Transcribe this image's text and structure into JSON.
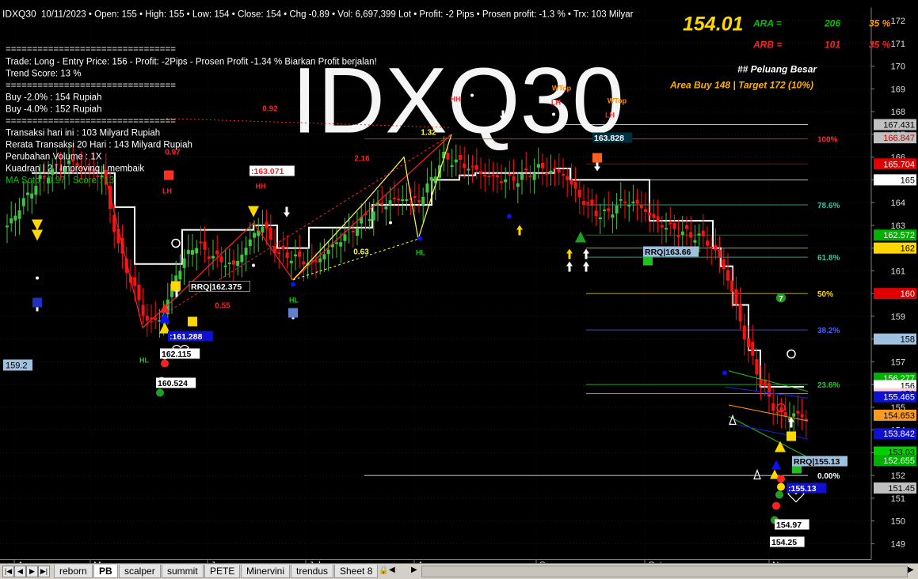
{
  "header": {
    "symbol": "IDXQ30",
    "stats": "10/11/2023  • Open: 155  • High: 155  • Low: 154  • Close: 154  • Chg -0.89  • Vol: 6,697,399 Lot  • Profit: -2 Pips  • Prosen profit: -1.3 %  • Trx: 103 Milyar",
    "last_price": "154.01",
    "ara_label": "ARA =",
    "ara_value": "206",
    "ara_pct": "35  %",
    "arb_label": "ARB =",
    "arb_value": "101",
    "arb_pct": "35  %",
    "peluang": "## Peluang Besar",
    "area_buy": "Area Buy 148 | Target 172 (10%)",
    "watermark": "IDXQ30"
  },
  "info_panel": {
    "rule": "================================",
    "lines": [
      "Trade: Long - Entry Price: 156 - Profit: -2Pips  -  Prosen Profit -1.34 % Biarkan Profit berjalan!",
      "Trend Score: 13 %",
      "================================",
      "Buy -2.0% : 154 Rupiah",
      "Buy -4.0% : 152 Rupiah",
      "================================",
      "Transaksi hari ini : 103 Milyard Rupiah",
      "Rerata Transaksi 20 Hari  : 143 Milyard Rupiah",
      "Perubahan Volume  : 1X",
      "Kuadran |  2 | Improving | membaik",
      "MA Soto  : 0.97  | Score  : 13"
    ]
  },
  "chart_data": {
    "type": "candlestick",
    "title": "IDXQ30",
    "x_labels": [
      "Apr",
      "May",
      "Jun",
      "Jul",
      "Aug",
      "Sep",
      "Oct",
      "Nov"
    ],
    "y_ticks": [
      149,
      150,
      151,
      152,
      153,
      154,
      155,
      156,
      157,
      158,
      159,
      160,
      161,
      162,
      163,
      164,
      165,
      166,
      167,
      168,
      169,
      170,
      171,
      172
    ],
    "ylim": [
      148.3,
      172.3
    ],
    "fib_levels": [
      {
        "label": "100%",
        "price": 166.8,
        "color": "#ff3030"
      },
      {
        "label": "78.6%",
        "price": 163.9,
        "color": "#3cc0a0"
      },
      {
        "label": "61.8%",
        "price": 161.6,
        "color": "#3cc0a0"
      },
      {
        "label": "50%",
        "price": 160.0,
        "color": "#ffd700"
      },
      {
        "label": "38.2%",
        "price": 158.4,
        "color": "#4060ff"
      },
      {
        "label": "23.6%",
        "price": 156.0,
        "color": "#22cc22"
      },
      {
        "label": "0.00%",
        "price": 152.0,
        "color": "#ffffff"
      }
    ],
    "price_tags": [
      {
        "text": "167.431",
        "price": 167.43,
        "bg": "#c0c0c0",
        "fg": "#000000"
      },
      {
        "text": "166.847",
        "price": 166.85,
        "bg": "#c0c0c0",
        "fg": "#cc0000"
      },
      {
        "text": "165.704",
        "price": 165.7,
        "bg": "#e00000",
        "fg": "#ffffff"
      },
      {
        "text": "165",
        "price": 165.0,
        "bg": "#ffffff",
        "fg": "#000000"
      },
      {
        "text": "162.572",
        "price": 162.57,
        "bg": "#00b000",
        "fg": "#ffffff"
      },
      {
        "text": "162",
        "price": 162.0,
        "bg": "#ffd700",
        "fg": "#000000"
      },
      {
        "text": "160",
        "price": 160.0,
        "bg": "#e00000",
        "fg": "#ffffff"
      },
      {
        "text": "158",
        "price": 158.0,
        "bg": "#a0c0e0",
        "fg": "#000000"
      },
      {
        "text": "156.277",
        "price": 156.28,
        "bg": "#00b000",
        "fg": "#ffffff"
      },
      {
        "text": "156",
        "price": 155.95,
        "bg": "#ffffff",
        "fg": "#000000"
      },
      {
        "text": "156",
        "price": 155.6,
        "bg": "#ffd0d0",
        "fg": "#000000"
      },
      {
        "text": "155.465",
        "price": 155.46,
        "bg": "#1010d0",
        "fg": "#ffffff"
      },
      {
        "text": "154.653",
        "price": 154.65,
        "bg": "#ff9a20",
        "fg": "#000000"
      },
      {
        "text": "153.842",
        "price": 153.84,
        "bg": "#1010d0",
        "fg": "#ffffff"
      },
      {
        "text": "153.03",
        "price": 153.03,
        "bg": "#00d000",
        "fg": "#000000"
      },
      {
        "text": "152.655",
        "price": 152.66,
        "bg": "#00b000",
        "fg": "#ffffff"
      },
      {
        "text": "151.45",
        "price": 151.45,
        "bg": "#c0c0c0",
        "fg": "#000000"
      }
    ],
    "left_tag": "159.2",
    "labels": [
      {
        "text": "RRQ|162.375"
      },
      {
        "text": ":161.288"
      },
      {
        "text": "162.115"
      },
      {
        "text": "160.524"
      },
      {
        "text": ":163.071"
      },
      {
        "text": "163.828"
      },
      {
        "text": "RRQ|163.66"
      },
      {
        "text": "RRQ|155.13"
      },
      {
        "text": ":155.13"
      },
      {
        "text": "154.97"
      },
      {
        "text": "154.25"
      }
    ],
    "annotations": [
      "0.97",
      "0.55",
      "2.16",
      "0.63",
      "0.92",
      "1.32",
      "LH",
      "HH",
      "HL",
      "WTop",
      "7"
    ]
  },
  "tabs": {
    "items": [
      "reborn",
      "PB",
      "scalper",
      "summit",
      "PETE",
      "Minervini",
      "trendus",
      "Sheet 8"
    ],
    "active": "PB"
  }
}
